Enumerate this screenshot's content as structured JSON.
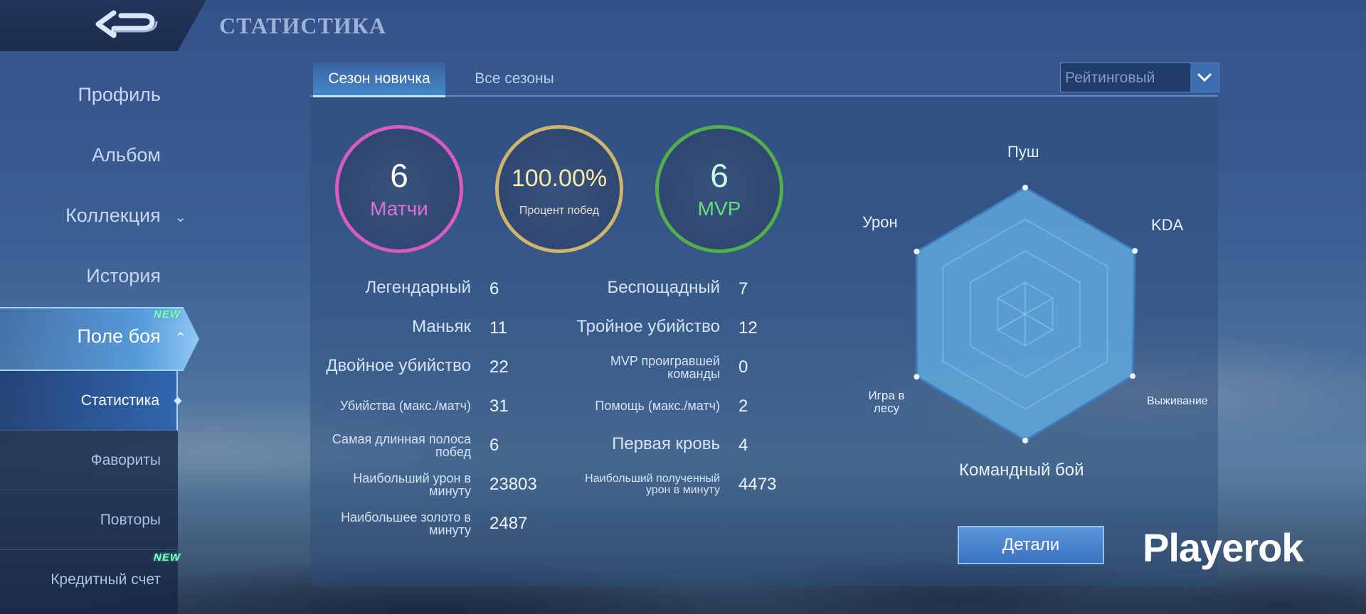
{
  "header": {
    "title": "СТАТИСТИКА"
  },
  "sidebar": {
    "items": [
      {
        "label": "Профиль"
      },
      {
        "label": "Альбом"
      },
      {
        "label": "Коллекция"
      },
      {
        "label": "История"
      },
      {
        "label": "Поле боя",
        "badge": "NEW"
      }
    ],
    "sub_items": [
      {
        "label": "Статистика"
      },
      {
        "label": "Фавориты"
      },
      {
        "label": "Повторы"
      },
      {
        "label": "Кредитный счет",
        "badge": "NEW"
      }
    ]
  },
  "tabs": [
    {
      "label": "Сезон новичка"
    },
    {
      "label": "Все сезоны"
    }
  ],
  "mode_select": {
    "value": "Рейтинговый"
  },
  "summary": {
    "matches": {
      "value": "6",
      "label": "Матчи",
      "color": "#d85bc0"
    },
    "winrate": {
      "value": "100.00%",
      "label": "Процент побед",
      "color": "#cdb56a"
    },
    "mvp": {
      "value": "6",
      "label": "MVP",
      "color": "#52b04a"
    }
  },
  "stats_left": [
    {
      "label": "Легендарный",
      "value": "6"
    },
    {
      "label": "Маньяк",
      "value": "11"
    },
    {
      "label": "Двойное убийство",
      "value": "22"
    },
    {
      "label": "Убийства (макс./матч)",
      "value": "31"
    },
    {
      "label": "Самая длинная полоса побед",
      "value": "6"
    },
    {
      "label": "Наибольший урон в минуту",
      "value": "23803"
    },
    {
      "label": "Наибольшее золото в минуту",
      "value": "2487"
    }
  ],
  "stats_right": [
    {
      "label": "Беспощадный",
      "value": "7"
    },
    {
      "label": "Тройное убийство",
      "value": "12"
    },
    {
      "label": "MVP проигравшей команды",
      "value": "0"
    },
    {
      "label": "Помощь (макс./матч)",
      "value": "2"
    },
    {
      "label": "Первая кровь",
      "value": "4"
    },
    {
      "label": "Наибольший полученный урон в минуту",
      "value": "4473"
    }
  ],
  "radar": {
    "axes": [
      "Пуш",
      "KDA",
      "Выживание",
      "Командный бой",
      "Игра в лесу",
      "Урон"
    ],
    "values": [
      1.0,
      1.0,
      0.98,
      1.0,
      0.99,
      0.99
    ],
    "fill_color": "#5fa8dc"
  },
  "details_button": {
    "label": "Детали"
  },
  "watermark": {
    "text": "Playerok"
  }
}
